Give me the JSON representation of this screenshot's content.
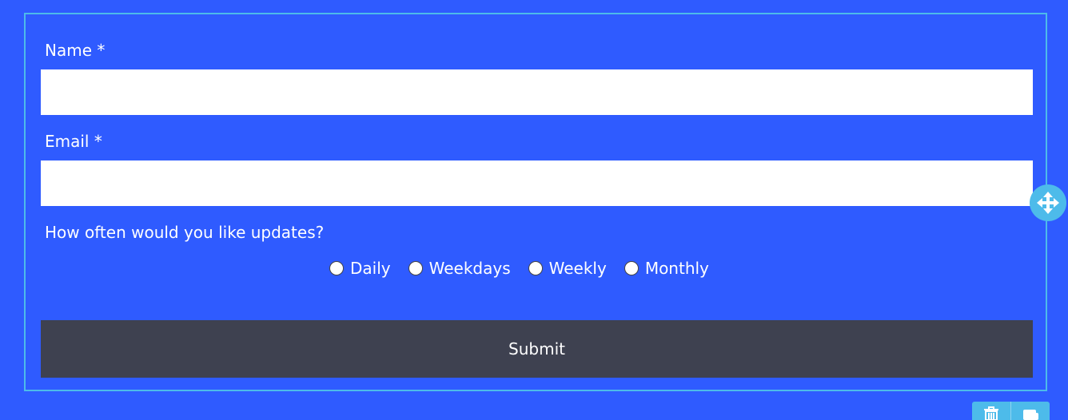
{
  "form": {
    "name_label": "Name *",
    "name_value": "",
    "email_label": "Email *",
    "email_value": "",
    "frequency_question": "How often would you like updates?",
    "frequency_options": [
      "Daily",
      "Weekdays",
      "Weekly",
      "Monthly"
    ],
    "submit_label": "Submit"
  },
  "editor": {
    "move_icon": "move-arrows-icon",
    "toolbar_icons": [
      "trash-icon",
      "duplicate-icon"
    ]
  },
  "colors": {
    "background": "#2f5bff",
    "frame_border": "#4dbbea",
    "submit_bg": "#3e4150",
    "input_bg": "#ffffff"
  }
}
